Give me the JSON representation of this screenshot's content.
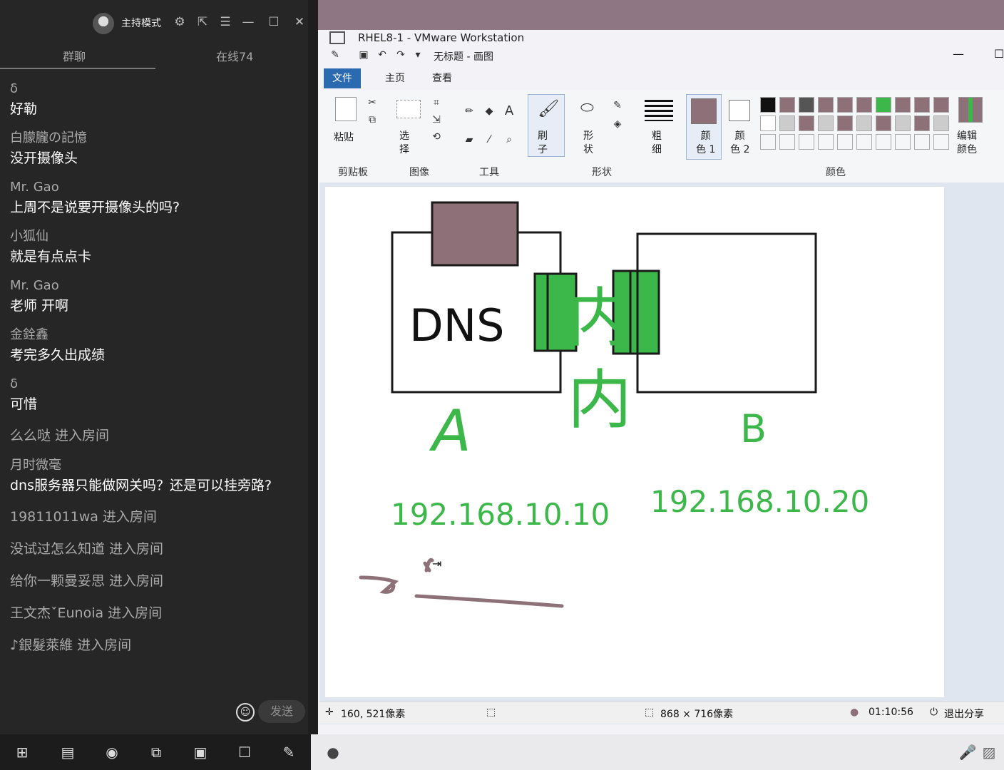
{
  "chat": {
    "mode_label": "主持模式",
    "tabs": {
      "group": "群聊",
      "online": "在线74"
    },
    "messages": [
      {
        "user": "δ",
        "text": "好勒"
      },
      {
        "user": "白朦朧の記憶",
        "text": "没开摄像头"
      },
      {
        "user": "Mr. Gao",
        "text": "上周不是说要开摄像头的吗?"
      },
      {
        "user": "小狐仙",
        "text": "就是有点点卡"
      },
      {
        "user": "Mr. Gao",
        "text": "老师 开啊"
      },
      {
        "user": "金銓鑫",
        "text": "考完多久出成绩"
      },
      {
        "user": "δ",
        "text": "可惜"
      }
    ],
    "join_1": "么么哒 进入房间",
    "last_message": {
      "user": "月时微毫",
      "text": "dns服务器只能做网关吗？还是可以挂旁路?"
    },
    "joins": [
      "19811011wa 进入房间",
      "没试过怎么知道 进入房间",
      "给你一颗曼妥思 进入房间",
      "王文杰ˇEunoia 进入房间",
      "♪銀髮萊維 进入房间"
    ],
    "send_label": "发送"
  },
  "vmware": {
    "title": "RHEL8-1 - VMware Workstation"
  },
  "paint": {
    "title": "无标题 - 画图",
    "tabs": [
      "文件",
      "主页",
      "查看"
    ],
    "ribbon": {
      "paste": "粘贴",
      "select": "选\n择",
      "brush": "刷\n子",
      "shapes": "形\n状",
      "size": "粗\n细",
      "color1": "颜\n色 1",
      "color2": "颜\n色 2",
      "edit_colors": "编辑\n颜色",
      "groups": {
        "clipboard": "剪贴板",
        "image": "图像",
        "tools": "工具",
        "shapes": "形状",
        "colors": "颜色"
      }
    },
    "colors": {
      "color1": "#8e7078",
      "color2": "#ffffff",
      "palette_row1": [
        "#111111",
        "#8e7078",
        "#555555",
        "#8e7078",
        "#8e7078",
        "#8e7078",
        "#3cb84a",
        "#8e7078",
        "#8e7078",
        "#8e7078"
      ],
      "palette_row2": [
        "#ffffff",
        "#cccccc",
        "#8e7078",
        "#cccccc",
        "#8e7078",
        "#cccccc",
        "#8e7078",
        "#cccccc",
        "#8e7078",
        "#cccccc"
      ],
      "drawing_green": "#3cb84a",
      "drawing_mauve": "#8e7078"
    },
    "canvas": {
      "label_dns": "DNS",
      "label_a": "A",
      "label_b": "B",
      "label_mid": "内",
      "ip_a": "192.168.10.10",
      "ip_b": "192.168.10.20"
    },
    "status": {
      "cursor_pos": "160, 521像素",
      "image_size": "868 × 716像素",
      "timer": "01:10:56",
      "exit_share": "退出分享"
    }
  }
}
